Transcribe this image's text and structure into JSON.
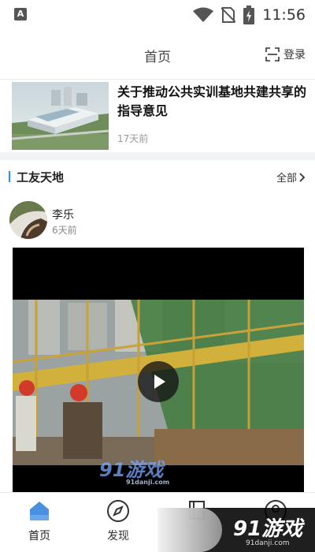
{
  "status_bar": {
    "time": "11:56",
    "app_icon": "A"
  },
  "header": {
    "title": "首页",
    "login_label": "登录"
  },
  "article": {
    "title": "关于推动公共实训基地共建共享的指导意见",
    "date": "17天前"
  },
  "section": {
    "title": "工友天地",
    "more_label": "全部"
  },
  "post": {
    "user_name": "李乐",
    "time": "6天前"
  },
  "video": {
    "watermark": "91游戏",
    "watermark_sub": "91danji.com"
  },
  "tabbar": {
    "items": [
      {
        "label": "首页",
        "icon": "home-icon",
        "active": true
      },
      {
        "label": "发现",
        "icon": "compass-icon",
        "active": false
      },
      {
        "label": "",
        "icon": "book-icon",
        "active": false
      },
      {
        "label": "",
        "icon": "user-icon",
        "active": false
      }
    ]
  },
  "corner_watermark": {
    "text": "91游戏",
    "sub": "91danji.com"
  },
  "colors": {
    "accent": "#2b8cf0",
    "home_icon": "#4a90e2"
  }
}
